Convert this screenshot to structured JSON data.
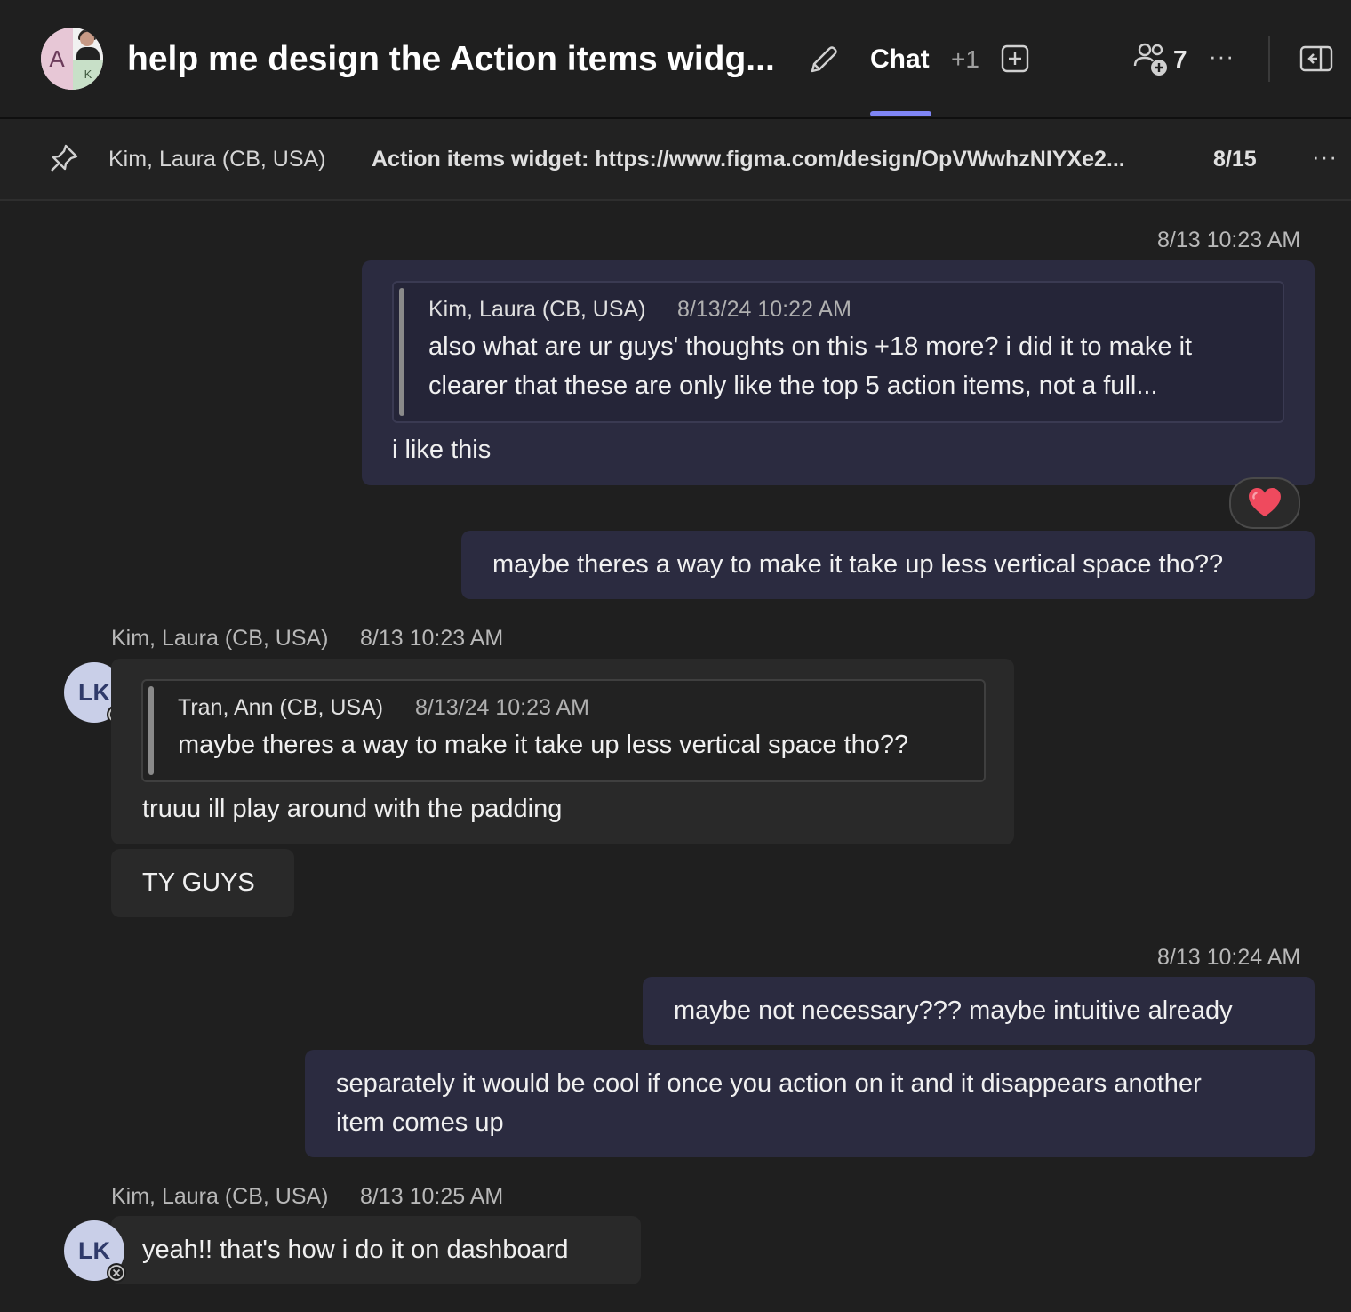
{
  "header": {
    "title": "help me design the Action items widg...",
    "avatar_letter": "A",
    "avatar_letter_2": "K",
    "tab_chat": "Chat",
    "tab_more": "+1",
    "participants_count": "7"
  },
  "pinned": {
    "author": "Kim, Laura (CB, USA)",
    "text": "Action items widget: https://www.figma.com/design/OpVWwhzNIYXe2...",
    "date": "8/15"
  },
  "messages": [
    {
      "timestamp": "8/13 10:23 AM",
      "quote": {
        "author": "Kim, Laura (CB, USA)",
        "date": "8/13/24 10:22 AM",
        "text": "also what are ur guys' thoughts on this +18 more? i did it to make it clearer that these are only like the top 5 action items, not a full..."
      },
      "text": "i like this",
      "reaction": "heart"
    },
    {
      "text": "maybe theres a way to make it take up less vertical space tho??"
    },
    {
      "sender": "Kim, Laura (CB, USA)",
      "timestamp": "8/13 10:23 AM",
      "avatar": "LK",
      "quote": {
        "author": "Tran, Ann (CB, USA)",
        "date": "8/13/24 10:23 AM",
        "text": "maybe theres a way to make it take up less vertical space tho??"
      },
      "text": "truuu ill play around with the padding"
    },
    {
      "text": "TY GUYS"
    },
    {
      "timestamp": "8/13 10:24 AM",
      "text": "maybe not necessary??? maybe intuitive already"
    },
    {
      "text": "separately it would be cool if once you action on it and it disappears another item comes up"
    },
    {
      "sender": "Kim, Laura (CB, USA)",
      "timestamp": "8/13 10:25 AM",
      "avatar": "LK",
      "text": "yeah!! that's how i do it on dashboard"
    }
  ],
  "colors": {
    "accent": "#7f85f5",
    "my_bubble": "#2b2b40",
    "other_bubble": "#292929",
    "background": "#1f1f1f"
  },
  "icons": [
    "edit-icon",
    "add-tab-icon",
    "people-add-icon",
    "more-icon",
    "panel-icon",
    "pin-icon",
    "heart-icon",
    "status-offline-icon"
  ]
}
